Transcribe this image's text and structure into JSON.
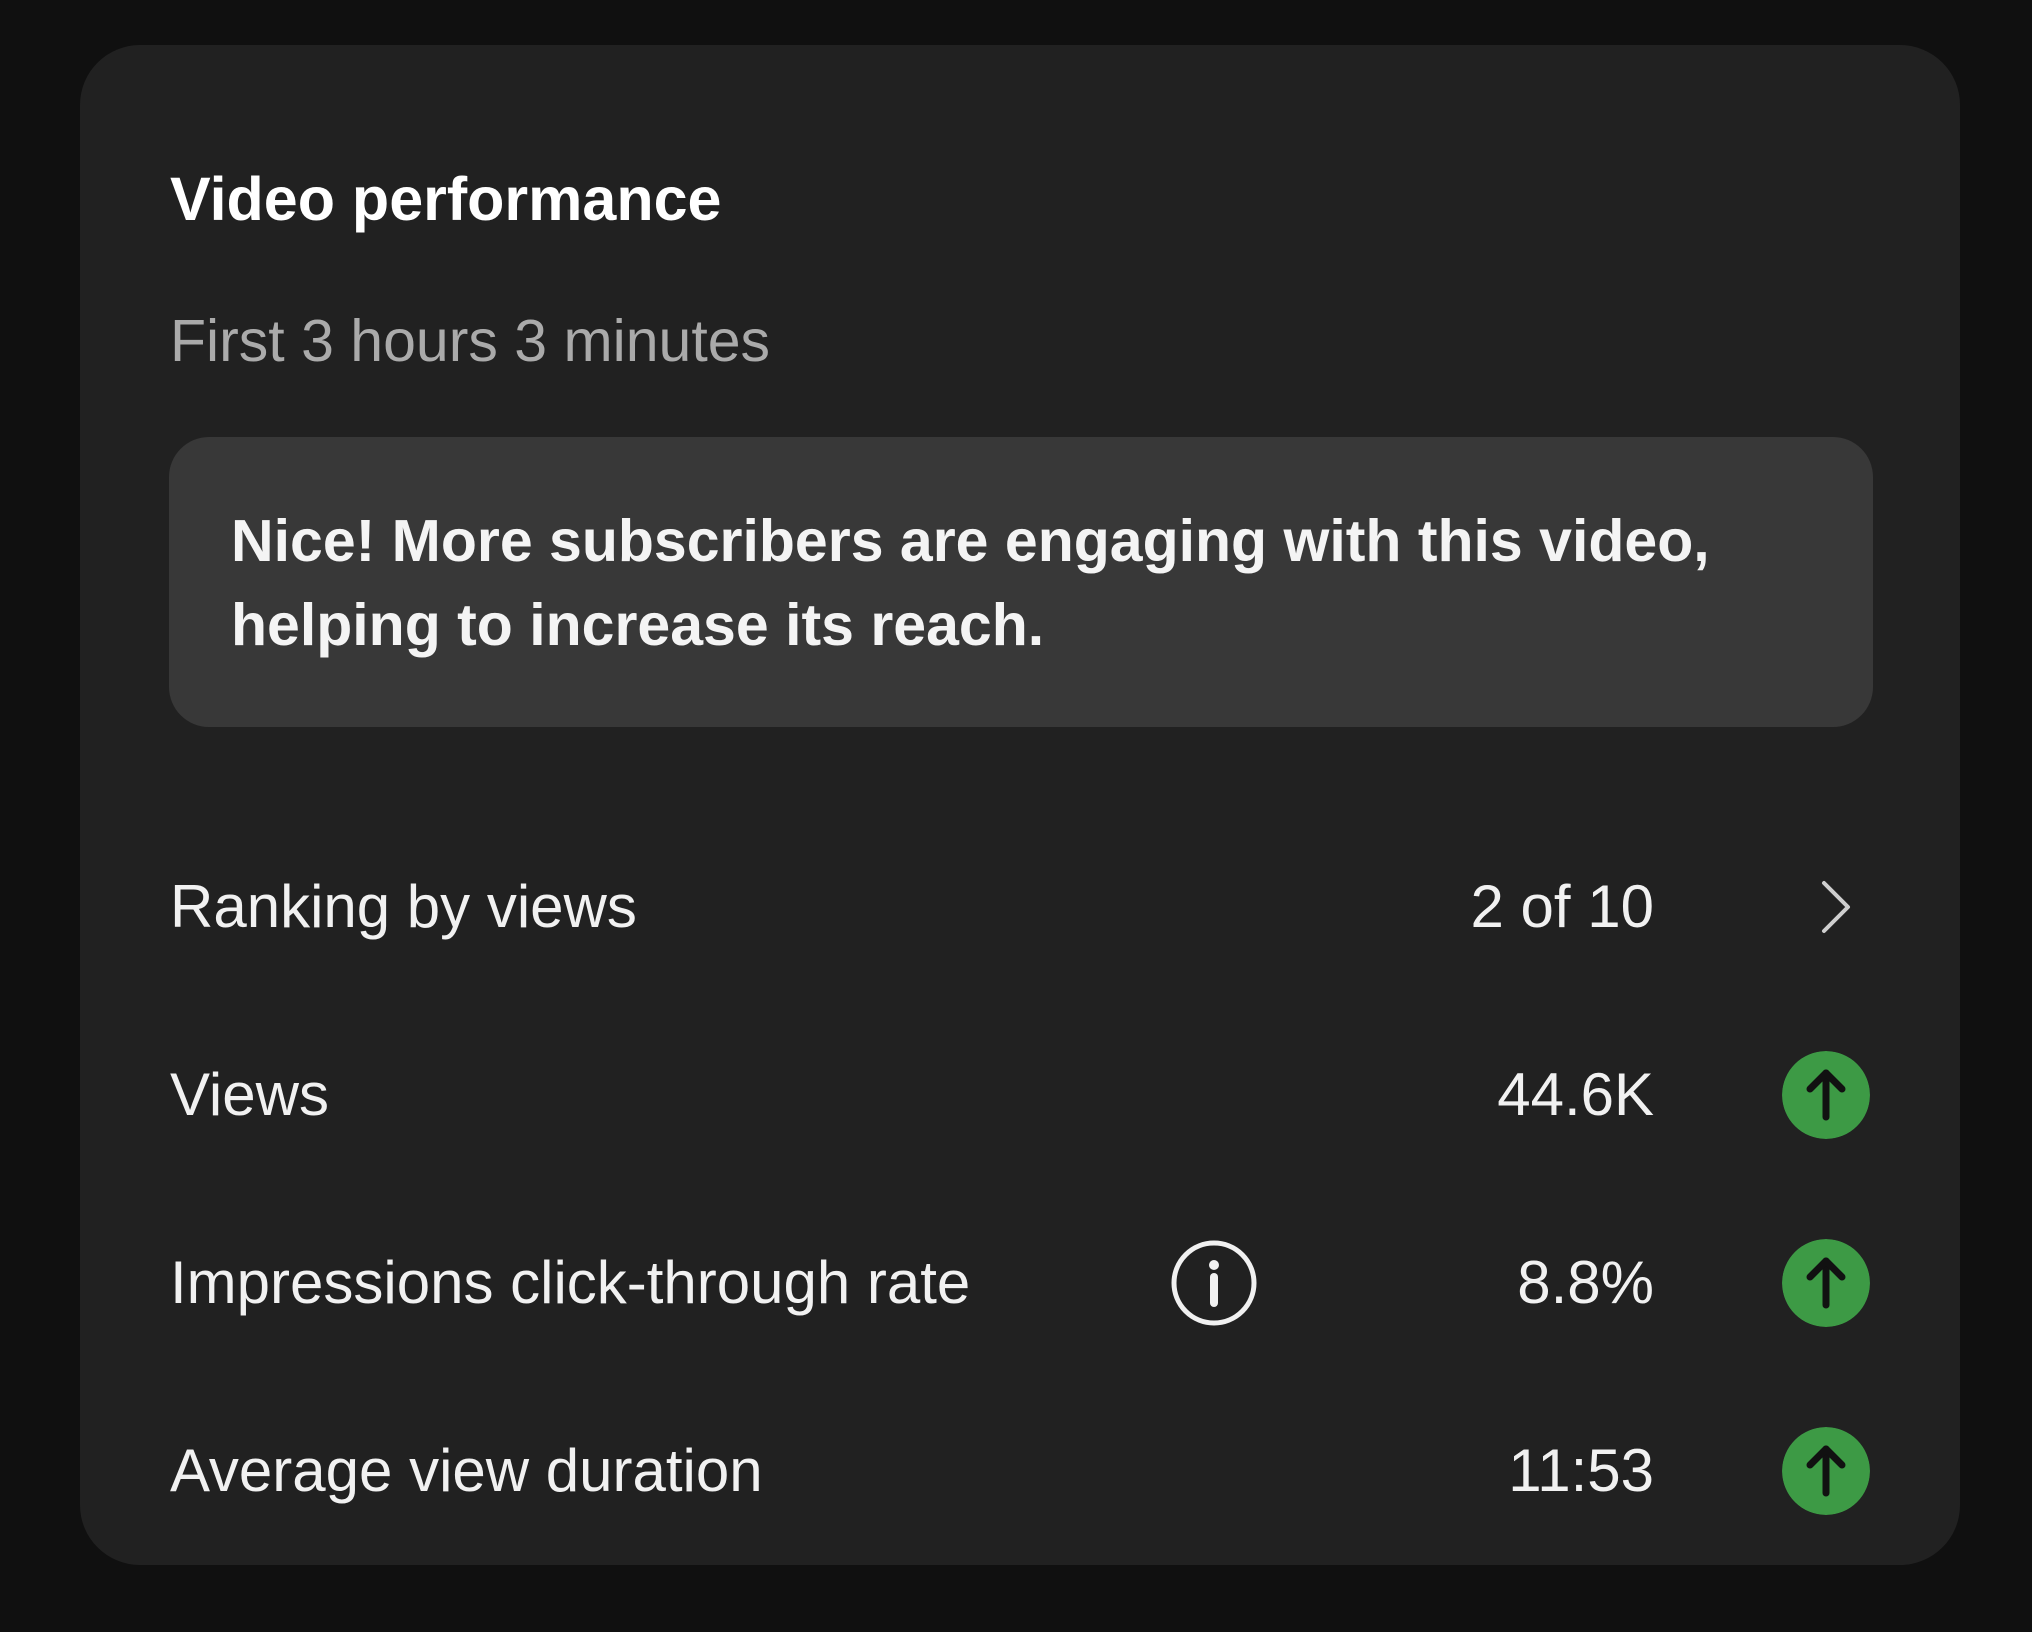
{
  "card": {
    "title": "Video performance",
    "subtitle": "First 3 hours 3 minutes",
    "insight": "Nice! More subscribers are engaging with this video, helping to increase its reach."
  },
  "metrics": [
    {
      "label": "Ranking by views",
      "value": "2 of 10",
      "indicator": "chevron-right-icon"
    },
    {
      "label": "Views",
      "value": "44.6K",
      "indicator": "arrow-up-circle-icon",
      "trend": "up"
    },
    {
      "label": "Impressions click-through rate",
      "value": "8.8%",
      "indicator": "arrow-up-circle-icon",
      "trend": "up",
      "has_info": true
    },
    {
      "label": "Average view duration",
      "value": "11:53",
      "indicator": "arrow-up-circle-icon",
      "trend": "up"
    }
  ],
  "colors": {
    "background": "#101010",
    "card": "#212121",
    "insight_box": "#383838",
    "trend_up": "#3d9a45",
    "subtitle": "#aaaaaa"
  }
}
